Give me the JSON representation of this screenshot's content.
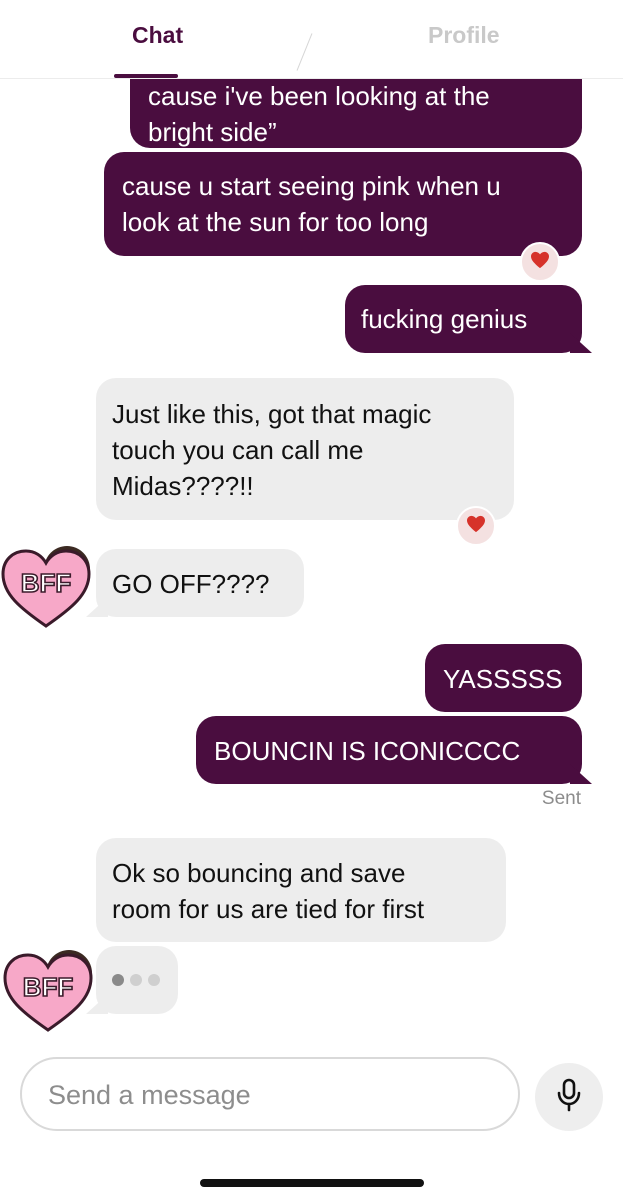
{
  "header": {
    "tabs": [
      {
        "label": "Chat",
        "active": true
      },
      {
        "label": "Profile",
        "active": false
      }
    ]
  },
  "messages": [
    {
      "direction": "out",
      "text": "cause i've been looking at the\nbright side”",
      "partial": true
    },
    {
      "direction": "out",
      "text": "cause u start seeing pink when u\nlook at the sun for too long",
      "reaction": "heart-icon"
    },
    {
      "direction": "out",
      "text": "fucking genius"
    },
    {
      "direction": "in",
      "text": "Just like this, got that magic\ntouch you can call me\nMidas????!!",
      "reaction": "heart-icon"
    },
    {
      "direction": "in",
      "text": "GO OFF????",
      "sender_badge": "BFF"
    },
    {
      "direction": "out",
      "text": "YASSSSS"
    },
    {
      "direction": "out",
      "text": "BOUNCIN IS ICONICCCC",
      "status": "Sent"
    },
    {
      "direction": "in",
      "text": "Ok so bouncing and save\nroom for us are tied for first"
    },
    {
      "direction": "in",
      "typing": true,
      "sender_badge": "BFF"
    }
  ],
  "composer": {
    "placeholder": "Send a message",
    "value": "",
    "mic_icon": "microphone-icon"
  },
  "colors": {
    "accent": "#4a0d3f",
    "incoming_bubble": "#ededed",
    "badge_pink": "#f7a8c8",
    "heart_red": "#d6322a"
  }
}
